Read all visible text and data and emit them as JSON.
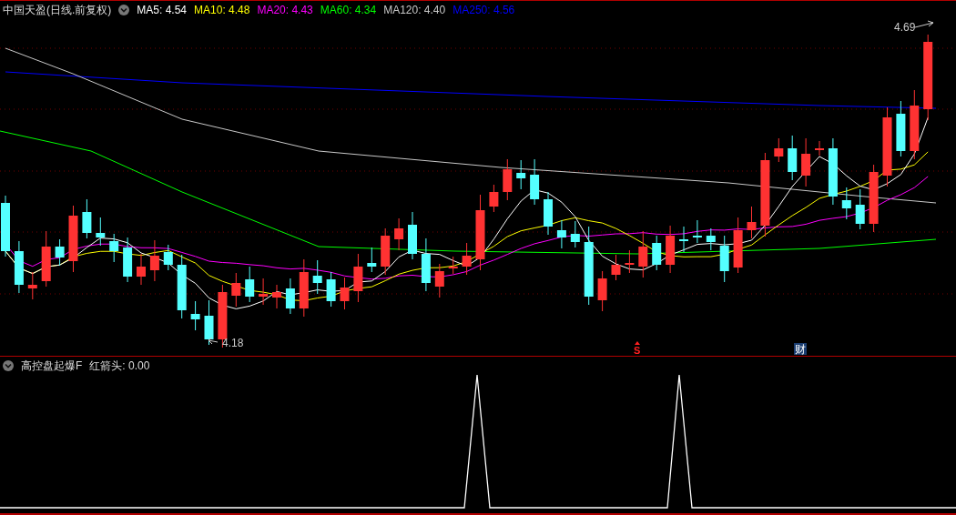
{
  "main_chart": {
    "title": "中国天盈(日线.前复权)",
    "indicators": [
      {
        "label": "MA5: 4.54",
        "color": "#ffffff"
      },
      {
        "label": "MA10: 4.48",
        "color": "#ffff00"
      },
      {
        "label": "MA20: 4.43",
        "color": "#ff00ff"
      },
      {
        "label": "MA60: 4.34",
        "color": "#00ff00"
      },
      {
        "label": "MA120: 4.40",
        "color": "#c8c8c8"
      },
      {
        "label": "MA250: 4.56",
        "color": "#0000ff"
      }
    ],
    "high_label": "4.69",
    "low_label": "4.18",
    "markers": [
      {
        "kind": "signal",
        "text": "S"
      },
      {
        "kind": "finance",
        "text": "财"
      }
    ]
  },
  "sub_chart": {
    "title": "高控盘起爆F",
    "value_label": "红箭头: 0.00"
  }
}
